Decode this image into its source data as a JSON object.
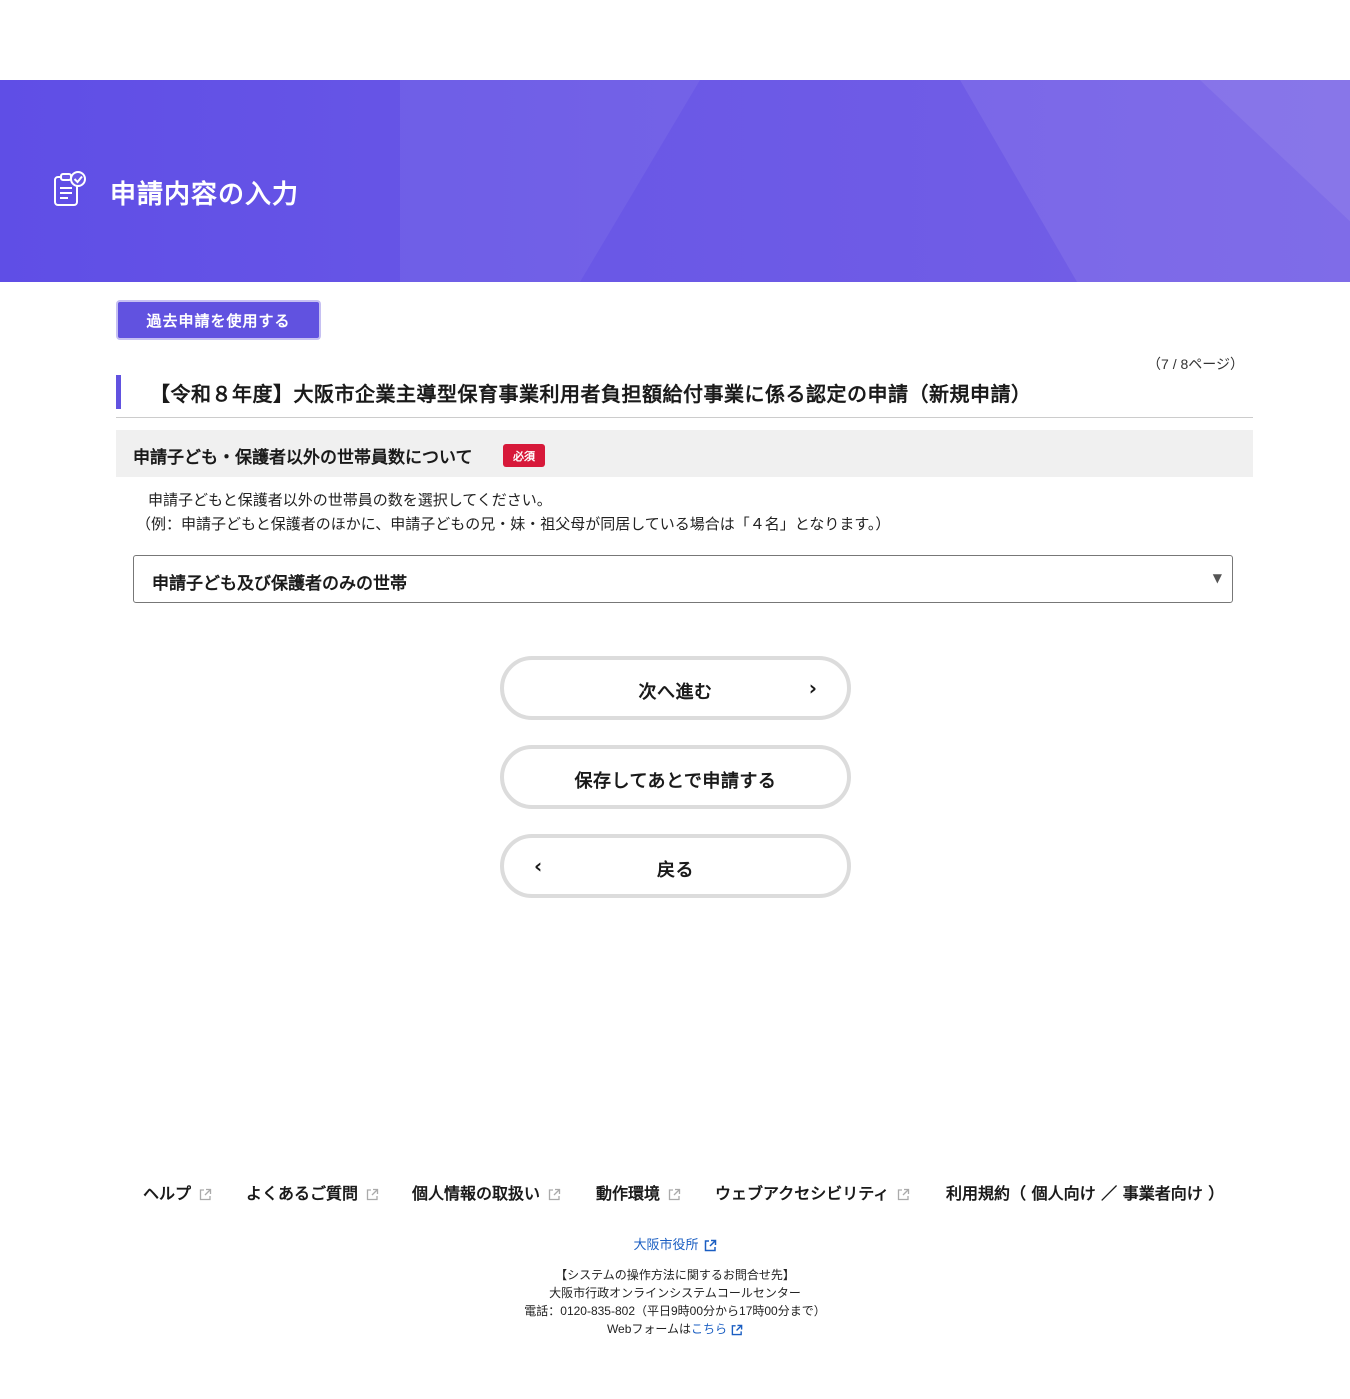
{
  "header": {
    "title": "申請内容の入力",
    "icon": "checklist-icon",
    "background_color": "#6152e0"
  },
  "actions": {
    "reuse_label": "過去申請を使用する"
  },
  "form": {
    "page_indicator": "（7 / 8ページ）",
    "title": "【令和８年度】大阪市企業主導型保育事業利用者負担額給付事業に係る認定の申請（新規申請）",
    "question": {
      "title": "申請子ども・保護者以外の世帯員数について",
      "required_label": "必須",
      "description_1": "申請子どもと保護者以外の世帯員の数を選択してください。",
      "description_2": "（例：申請子どもと保護者のほかに、申請子どもの兄・妹・祖父母が同居している場合は「４名」となります。）",
      "selected_value": "申請子ども及び保護者のみの世帯"
    }
  },
  "buttons": {
    "next_label": "次へ進む",
    "save_label": "保存してあとで申請する",
    "back_label": "戻る"
  },
  "footer": {
    "links": [
      {
        "label": "ヘルプ"
      },
      {
        "label": "よくあるご質問"
      },
      {
        "label": "個人情報の取扱い"
      },
      {
        "label": "動作環境"
      },
      {
        "label": "ウェブアクセシビリティ"
      },
      {
        "label": "利用規約（ 個人向け ／ 事業者向け ）"
      }
    ],
    "city_link": "大阪市役所",
    "contact_heading": "【システムの操作方法に関するお問合せ先】",
    "contact_center": "大阪市行政オンラインシステムコールセンター",
    "contact_phone": "電話：0120-835-802（平日9時00分から17時00分まで）",
    "webform_prefix": "Webフォームは",
    "webform_link": "こちら"
  },
  "colors": {
    "accent": "#6152e0",
    "required": "#d7193a",
    "link": "#1a5ec2"
  }
}
